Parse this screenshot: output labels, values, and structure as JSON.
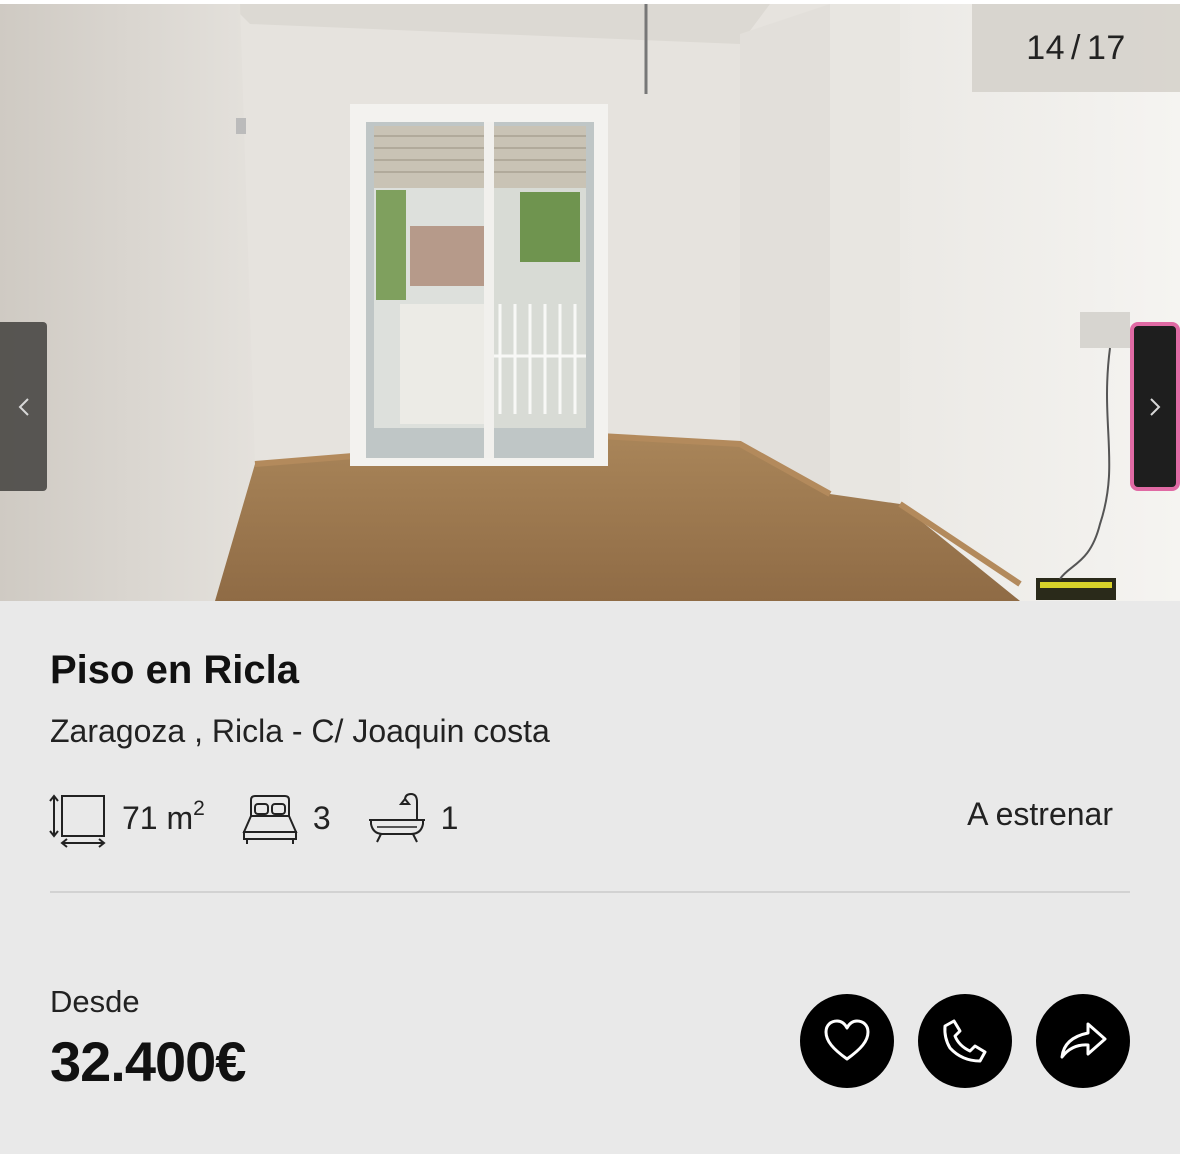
{
  "gallery": {
    "current": "14",
    "separator": "/",
    "total": "17",
    "prev_icon": "chevron-left-icon",
    "next_icon": "chevron-right-icon",
    "focus_color": "#e06aa4"
  },
  "listing": {
    "title": "Piso en Ricla",
    "address": "Zaragoza , Ricla - C/ Joaquin costa",
    "area_value": "71 m",
    "area_unit_sup": "2",
    "bedrooms": "3",
    "bathrooms": "1",
    "condition": "A estrenar",
    "price_label": "Desde",
    "price": "32.400€"
  },
  "icons": {
    "area": "area-icon",
    "bed": "bed-icon",
    "bath": "bathtub-icon",
    "favorite": "heart-icon",
    "call": "phone-icon",
    "share": "share-icon"
  },
  "colors": {
    "card_bg": "#e9e9e9",
    "action_bg": "#000000"
  }
}
